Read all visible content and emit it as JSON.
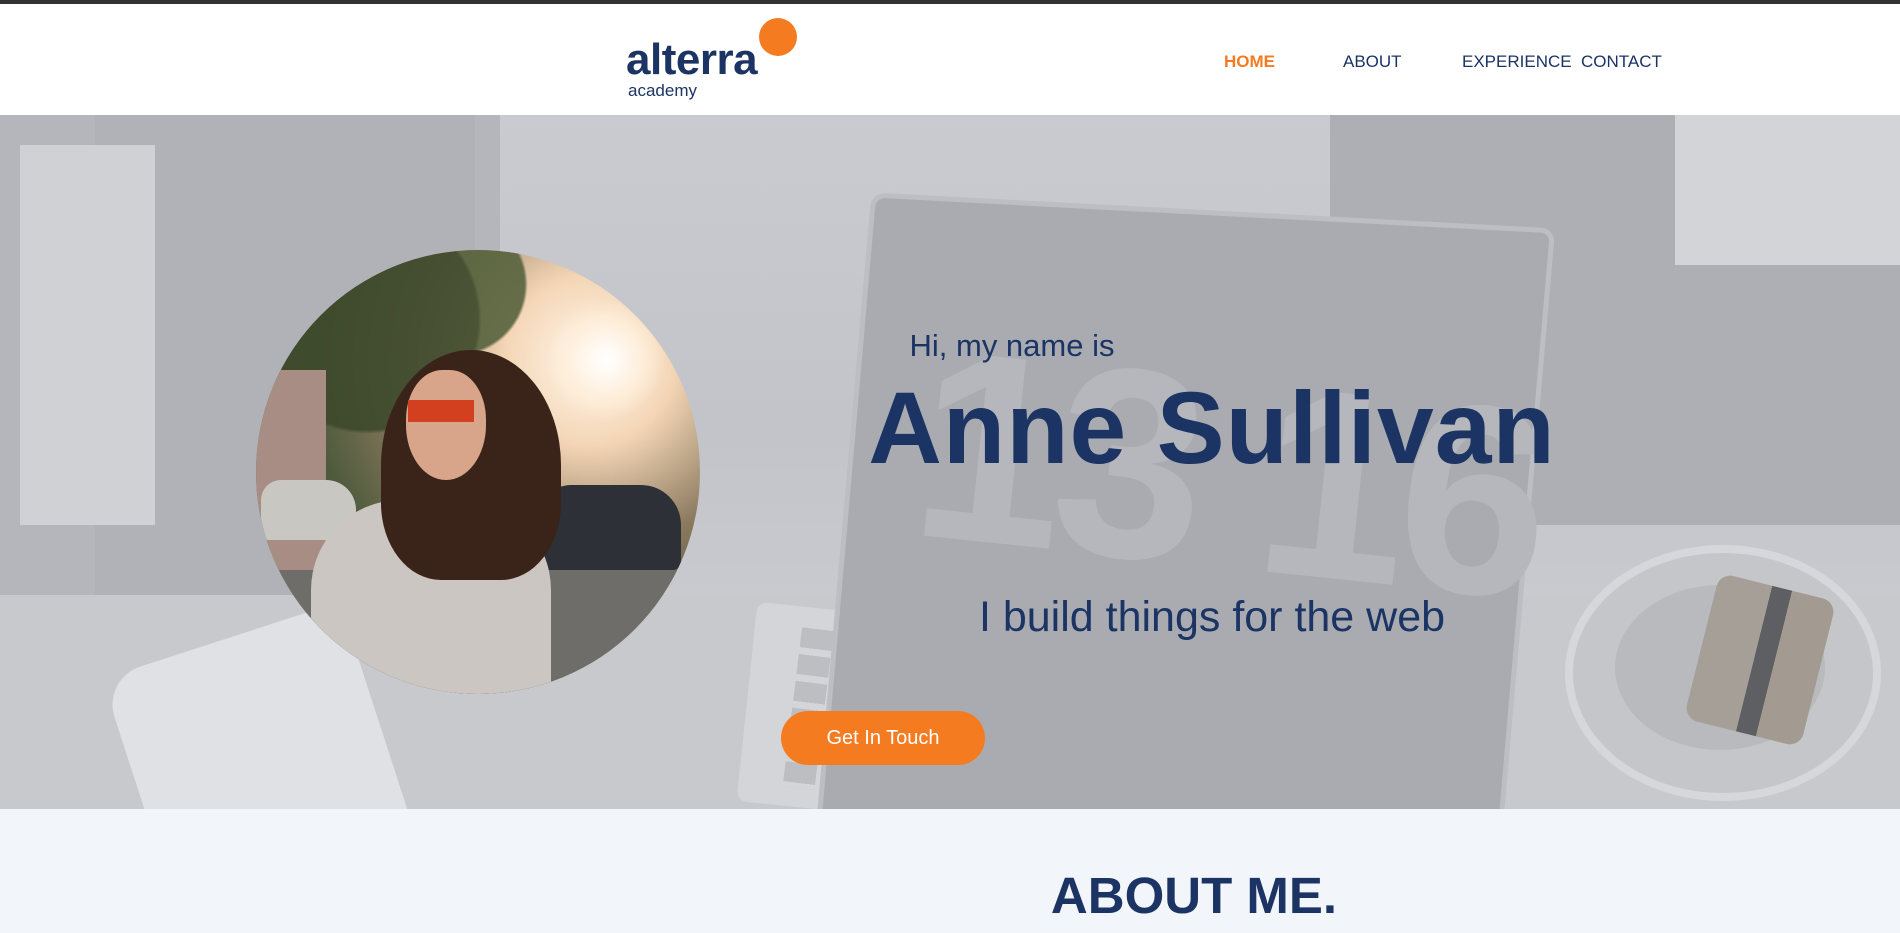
{
  "brand": {
    "name": "alterra",
    "sub": "academy",
    "accent_color": "#f47b20",
    "primary_color": "#1b3464"
  },
  "nav": {
    "items": [
      {
        "label": "HOME",
        "active": true
      },
      {
        "label": "ABOUT",
        "active": false
      },
      {
        "label": "EXPERIENCE",
        "active": false
      },
      {
        "label": "CONTACT",
        "active": false
      }
    ]
  },
  "hero": {
    "intro": "Hi, my name is",
    "name": "Anne Sullivan",
    "tagline": "I build things for the web",
    "cta_label": "Get In Touch",
    "laptop_display_text": "13 16"
  },
  "about": {
    "title": "ABOUT ME."
  }
}
